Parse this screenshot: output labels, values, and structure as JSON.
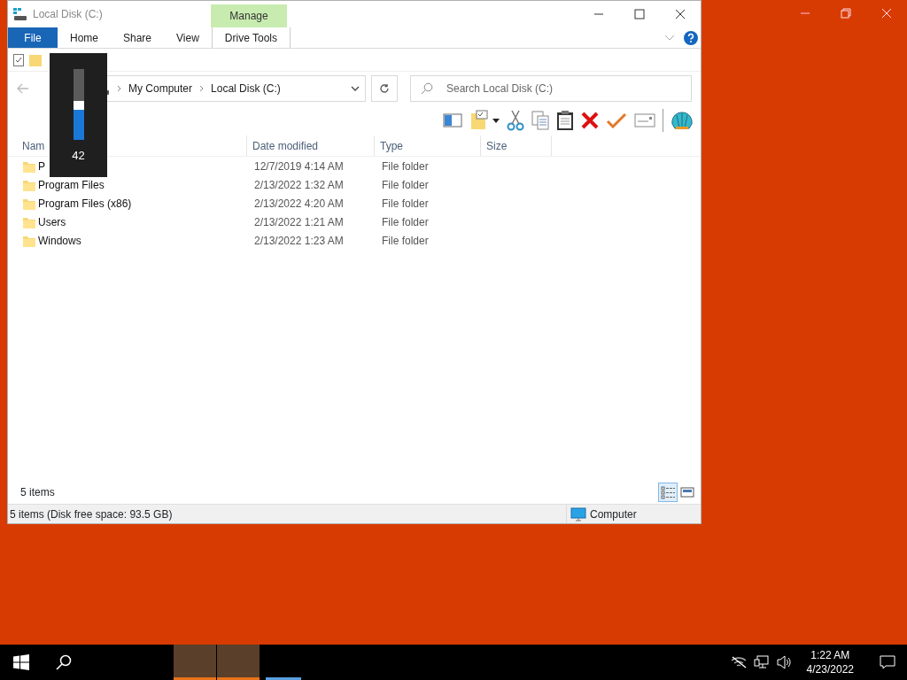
{
  "window": {
    "title": "Local Disk (C:)",
    "context_group": "Manage"
  },
  "ribbon_tabs": [
    {
      "label": "File",
      "kind": "file"
    },
    {
      "label": "Home",
      "kind": "normal"
    },
    {
      "label": "Share",
      "kind": "normal"
    },
    {
      "label": "View",
      "kind": "normal"
    },
    {
      "label": "Drive Tools",
      "kind": "context"
    }
  ],
  "address": {
    "path": [
      "My Computer",
      "Local Disk (C:)"
    ]
  },
  "search": {
    "placeholder": "Search Local Disk (C:)"
  },
  "columns": [
    "Nam",
    "Date modified",
    "Type",
    "Size"
  ],
  "rows": [
    {
      "name": "P",
      "date": "12/7/2019 4:14 AM",
      "type": "File folder"
    },
    {
      "name": "Program Files",
      "date": "2/13/2022 1:32 AM",
      "type": "File folder"
    },
    {
      "name": "Program Files (x86)",
      "date": "2/13/2022 4:20 AM",
      "type": "File folder"
    },
    {
      "name": "Users",
      "date": "2/13/2022 1:21 AM",
      "type": "File folder"
    },
    {
      "name": "Windows",
      "date": "2/13/2022 1:23 AM",
      "type": "File folder"
    }
  ],
  "item_count": "5 items",
  "view_buttons": [
    {
      "kind": "details",
      "selected": true
    },
    {
      "kind": "preview",
      "selected": false
    }
  ],
  "status_bar": {
    "text": "5 items (Disk free space: 93.5 GB)",
    "location": "Computer"
  },
  "volume": {
    "level": 0.42,
    "reading": "42"
  },
  "taskbar": {
    "apps": [
      {
        "highlighted": true,
        "color": "#e8731a"
      },
      {
        "highlighted": true,
        "color": "#e8731a"
      },
      {
        "highlighted": false,
        "color": "#5aa0e0"
      }
    ],
    "time": "1:22 AM",
    "date": "4/23/2022"
  }
}
